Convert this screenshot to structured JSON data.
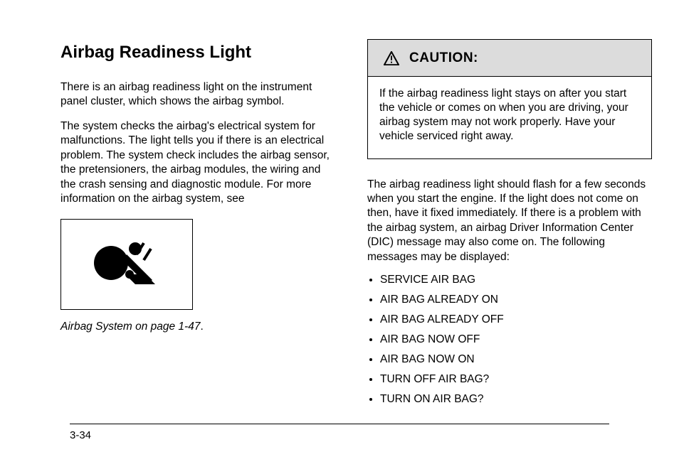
{
  "left": {
    "title": "Airbag Readiness Light",
    "p1": "There is an airbag readiness light on the instrument panel cluster, which shows the airbag symbol.",
    "p2": "The system checks the airbag's electrical system for malfunctions. The light tells you if there is an electrical problem. The system check includes the airbag sensor, the pretensioners, the airbag modules, the wiring and the crash sensing and diagnostic module. For more information on the airbag system, see ",
    "ref_ital": "Airbag System on page 1-47",
    "ref_after": "."
  },
  "caution": {
    "label": "CAUTION:",
    "body": "If the airbag readiness light stays on after you start the vehicle or comes on when you are driving, your airbag system may not work properly. Have your vehicle serviced right away.",
    "icon_name": "warning-triangle-icon"
  },
  "right": {
    "intro": "The airbag readiness light should flash for a few seconds when you start the engine. If the light does not come on then, have it fixed immediately. If there is a problem with the airbag system, an airbag Driver Information Center (DIC) message may also come on. The following messages may be displayed:",
    "bullets": [
      "SERVICE AIR BAG",
      "AIR BAG ALREADY ON",
      "AIR BAG ALREADY OFF",
      "AIR BAG NOW OFF",
      "AIR BAG NOW ON",
      "TURN OFF AIR BAG?",
      "TURN ON AIR BAG?"
    ]
  },
  "footer": {
    "page_num": "3-34"
  }
}
